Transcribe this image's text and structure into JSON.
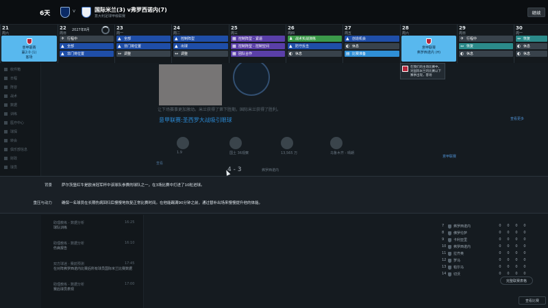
{
  "topbar": {
    "days": "6天",
    "vs": "v",
    "match_title": "国际米兰(3) v弗罗西诺内(7)",
    "match_sub": "意大利足球甲级联赛",
    "continue_label": "继续"
  },
  "calendar": {
    "month": "2027年8月",
    "days": [
      {
        "num": "21",
        "name": "周六",
        "events": []
      },
      {
        "num": "22",
        "name": "周日",
        "events": [
          {
            "label": "行程中",
            "color": "gray",
            "icon": "✈"
          },
          {
            "label": "全部",
            "color": "blue",
            "icon": "▲"
          },
          {
            "label": "非门将位置",
            "color": "blue",
            "icon": "▲"
          }
        ]
      },
      {
        "num": "23",
        "name": "周一",
        "events": [
          {
            "label": "全部",
            "color": "blue",
            "icon": "▲"
          },
          {
            "label": "非门将位置",
            "color": "blue",
            "icon": "▲"
          },
          {
            "label": "调整",
            "color": "gray",
            "icon": "↔"
          }
        ]
      },
      {
        "num": "24",
        "name": "周二",
        "events": [
          {
            "label": "控制阵型",
            "color": "blue",
            "icon": "▲"
          },
          {
            "label": "出球",
            "color": "blue",
            "icon": "▲"
          },
          {
            "label": "调整",
            "color": "gray",
            "icon": "↔"
          }
        ]
      },
      {
        "num": "25",
        "name": "周三",
        "events": [
          {
            "label": "控制阵型 - 紧逼",
            "color": "purple",
            "icon": "▦"
          },
          {
            "label": "控制阵型 - 控制空间",
            "color": "purple",
            "icon": "▦"
          },
          {
            "label": "团队合作",
            "color": "purple",
            "icon": "▦"
          }
        ]
      },
      {
        "num": "26",
        "name": "周四",
        "events": [
          {
            "label": "战术实战演练",
            "color": "green",
            "icon": "♟"
          },
          {
            "label": "防守反击",
            "color": "blue",
            "icon": "▲"
          },
          {
            "label": "休息",
            "color": "gray",
            "icon": "◐"
          }
        ]
      },
      {
        "num": "27",
        "name": "周五",
        "events": [
          {
            "label": "创造机会",
            "color": "blue",
            "icon": "▲"
          },
          {
            "label": "休息",
            "color": "gray",
            "icon": "◐"
          },
          {
            "label": "比赛准备",
            "color": "sky",
            "icon": "▤"
          }
        ]
      },
      {
        "num": "28",
        "name": "周六",
        "events": []
      },
      {
        "num": "29",
        "name": "周日",
        "events": [
          {
            "label": "行程中",
            "color": "gray",
            "icon": "✈"
          },
          {
            "label": "恢复",
            "color": "teal",
            "icon": "↔"
          },
          {
            "label": "休息",
            "color": "gray",
            "icon": "◐"
          }
        ]
      },
      {
        "num": "30",
        "name": "周一",
        "events": [
          {
            "label": "恢复",
            "color": "teal",
            "icon": "↔"
          },
          {
            "label": "休息",
            "color": "gray",
            "icon": "◐"
          },
          {
            "label": "休息",
            "color": "gray",
            "icon": "◐"
          }
        ]
      }
    ],
    "match_left": {
      "title": "意甲联赛",
      "score": "赢2:0 (1)",
      "sub": "客场"
    },
    "match_right": {
      "title": "意甲联赛",
      "opp": "弗罗西诺内 (H)",
      "sub": ""
    }
  },
  "popup": {
    "text": "在我们的主场比赛中，对国际米兰的比赛以下赛季出现，客场"
  },
  "news": {
    "body": "让下场赛事更加激动。米兰获得了第下胜期，国际米兰获得了胜利。",
    "title": "意甲联赛:圣西罗大战吸引眼球",
    "link": "查看",
    "score": "4 - 3",
    "score_team": "弗罗西诺内",
    "more": "查看更多"
  },
  "stats": [
    "1.9",
    "国土 36观察",
    "13,565 万",
    "乌鲁木齐 - 晴朗"
  ],
  "sidebar": [
    "收件箱",
    "日程",
    "阵容",
    "战术",
    "数据",
    "训练",
    "医疗中心",
    "球探",
    "转会",
    "俱乐部信息",
    "财政",
    "球员"
  ],
  "tooltip": {
    "label1": "背景",
    "text1": "萨尔茨堡红牛是欧洲冠军杯中该球队参赛的球队之一，在3场比赛中打进了10粒进球。",
    "label2": "重压与动力",
    "text2": "确保一名球员在长期伤病回归后慢慢地恢复正常比赛时间。在他能踢满90分钟之前，通过替补出场来慢慢提升他的体能。"
  },
  "inbox": [
    {
      "from": "助理教练 - 数据分析",
      "title": "球队训练",
      "time": "16:25"
    },
    {
      "from": "助理教练 - 数据分析",
      "title": "伤病报告",
      "time": "16:10"
    },
    {
      "from": "双方球迷 · 赛前预测",
      "title": "在对阵弗罗西诺内比赛后所有球员国际米兰比赛数据",
      "time": "17:45"
    },
    {
      "from": "助理教练 - 数据分析",
      "title": "赛后球员表现",
      "time": "17:00"
    }
  ],
  "league": {
    "title": "意甲联赛",
    "rows": [
      {
        "pos": "7",
        "name": "弗罗西诺内",
        "v": [
          "0",
          "0",
          "0",
          "0"
        ]
      },
      {
        "pos": "8",
        "name": "佛罗伦萨",
        "v": [
          "0",
          "0",
          "0",
          "0"
        ]
      },
      {
        "pos": "9",
        "name": "卡利亚里",
        "v": [
          "0",
          "0",
          "0",
          "0"
        ]
      },
      {
        "pos": "10",
        "name": "弗罗西诺内",
        "v": [
          "0",
          "0",
          "0",
          "0"
        ]
      },
      {
        "pos": "11",
        "name": "拉齐奥",
        "v": [
          "0",
          "0",
          "0",
          "0"
        ]
      },
      {
        "pos": "12",
        "name": "罗马",
        "v": [
          "0",
          "0",
          "0",
          "0"
        ]
      },
      {
        "pos": "13",
        "name": "帕尔马",
        "v": [
          "0",
          "0",
          "0",
          "0"
        ]
      },
      {
        "pos": "14",
        "name": "切沃",
        "v": [
          "0",
          "0",
          "0",
          "0"
        ]
      }
    ],
    "full_table": "完整联赛表格",
    "view_match": "查看比赛"
  },
  "colors": {
    "accent": "#2f8fd6",
    "match_card": "#58b8ee",
    "tooltip_bg": "#1a2026"
  }
}
